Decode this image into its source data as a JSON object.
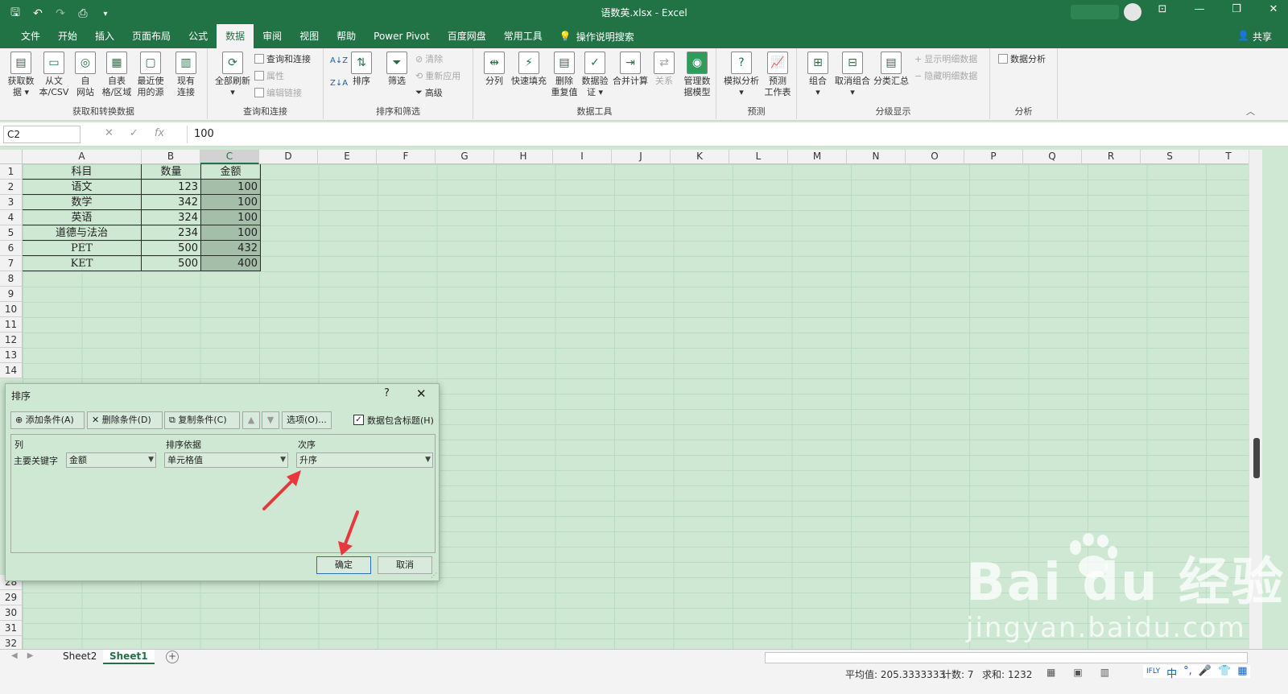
{
  "window": {
    "title": "语数英.xlsx  -  Excel"
  },
  "tabs": [
    "文件",
    "开始",
    "插入",
    "页面布局",
    "公式",
    "数据",
    "审阅",
    "视图",
    "帮助",
    "Power Pivot",
    "百度网盘",
    "常用工具"
  ],
  "active_tab": "数据",
  "tell_me": "操作说明搜索",
  "share": "共享",
  "ribbon": {
    "get_transform": {
      "label": "获取和转换数据",
      "buttons": [
        "获取数\n据 ▾",
        "从文\n本/CSV",
        "自\n网站",
        "自表\n格/区域",
        "最近使\n用的源",
        "现有\n连接"
      ]
    },
    "queries": {
      "label": "查询和连接",
      "refresh": "全部刷新\n▾",
      "items": [
        "查询和连接",
        "属性",
        "编辑链接"
      ]
    },
    "sort_filter": {
      "label": "排序和筛选",
      "sort": "排序",
      "filter": "筛选",
      "items": [
        "清除",
        "重新应用",
        "高级"
      ]
    },
    "data_tools": {
      "label": "数据工具",
      "buttons": [
        "分列",
        "快速填充",
        "删除\n重复值",
        "数据验\n证 ▾",
        "合并计算",
        "关系",
        "管理数\n据模型"
      ]
    },
    "forecast": {
      "label": "预测",
      "buttons": [
        "模拟分析\n▾",
        "预测\n工作表"
      ]
    },
    "outline": {
      "label": "分级显示",
      "buttons": [
        "组合\n▾",
        "取消组合\n▾",
        "分类汇总"
      ],
      "items": [
        "显示明细数据",
        "隐藏明细数据"
      ]
    },
    "analysis": {
      "label": "分析",
      "item": "数据分析"
    }
  },
  "formula_bar": {
    "name_box": "C2",
    "value": "100"
  },
  "columns": [
    "A",
    "B",
    "C",
    "D",
    "E",
    "F",
    "G",
    "H",
    "I",
    "J",
    "K",
    "L",
    "M",
    "N",
    "O",
    "P",
    "Q",
    "R",
    "S",
    "T"
  ],
  "rows_top": [
    "1",
    "2",
    "3",
    "4",
    "5",
    "6",
    "7",
    "8",
    "9",
    "10",
    "11",
    "12",
    "13",
    "14"
  ],
  "rows_bottom": [
    "28",
    "29",
    "30",
    "31",
    "32"
  ],
  "table": [
    [
      "科目",
      "数量",
      "金额"
    ],
    [
      "语文",
      "123",
      "100"
    ],
    [
      "数学",
      "342",
      "100"
    ],
    [
      "英语",
      "324",
      "100"
    ],
    [
      "道德与法治",
      "234",
      "100"
    ],
    [
      "PET",
      "500",
      "432"
    ],
    [
      "KET",
      "500",
      "400"
    ]
  ],
  "dialog": {
    "title": "排序",
    "help": "?",
    "close": "✕",
    "add_level": "添加条件(A)",
    "delete_level": "删除条件(D)",
    "copy_level": "复制条件(C)",
    "options": "选项(O)...",
    "has_headers": "数据包含标题(H)",
    "headers": [
      "列",
      "排序依据",
      "次序"
    ],
    "row_label": "主要关键字",
    "column_value": "金额",
    "sort_on_value": "单元格值",
    "order_value": "升序",
    "ok": "确定",
    "cancel": "取消"
  },
  "sheets": [
    "Sheet2",
    "Sheet1"
  ],
  "active_sheet": "Sheet1",
  "status": {
    "average": "平均值: 205.3333333",
    "count": "计数: 7",
    "sum": "求和: 1232"
  },
  "tray": [
    "IFLY",
    "中",
    "°,",
    "🎤",
    "👕",
    "▦"
  ],
  "watermark": {
    "main": "Bai du 经验",
    "sub": "jingyan.baidu.com"
  },
  "colors": {
    "excel_green": "#217346",
    "sheet_bg": "#cfe8d3",
    "selection": "#a5bea9",
    "arrow": "#e8383d"
  }
}
